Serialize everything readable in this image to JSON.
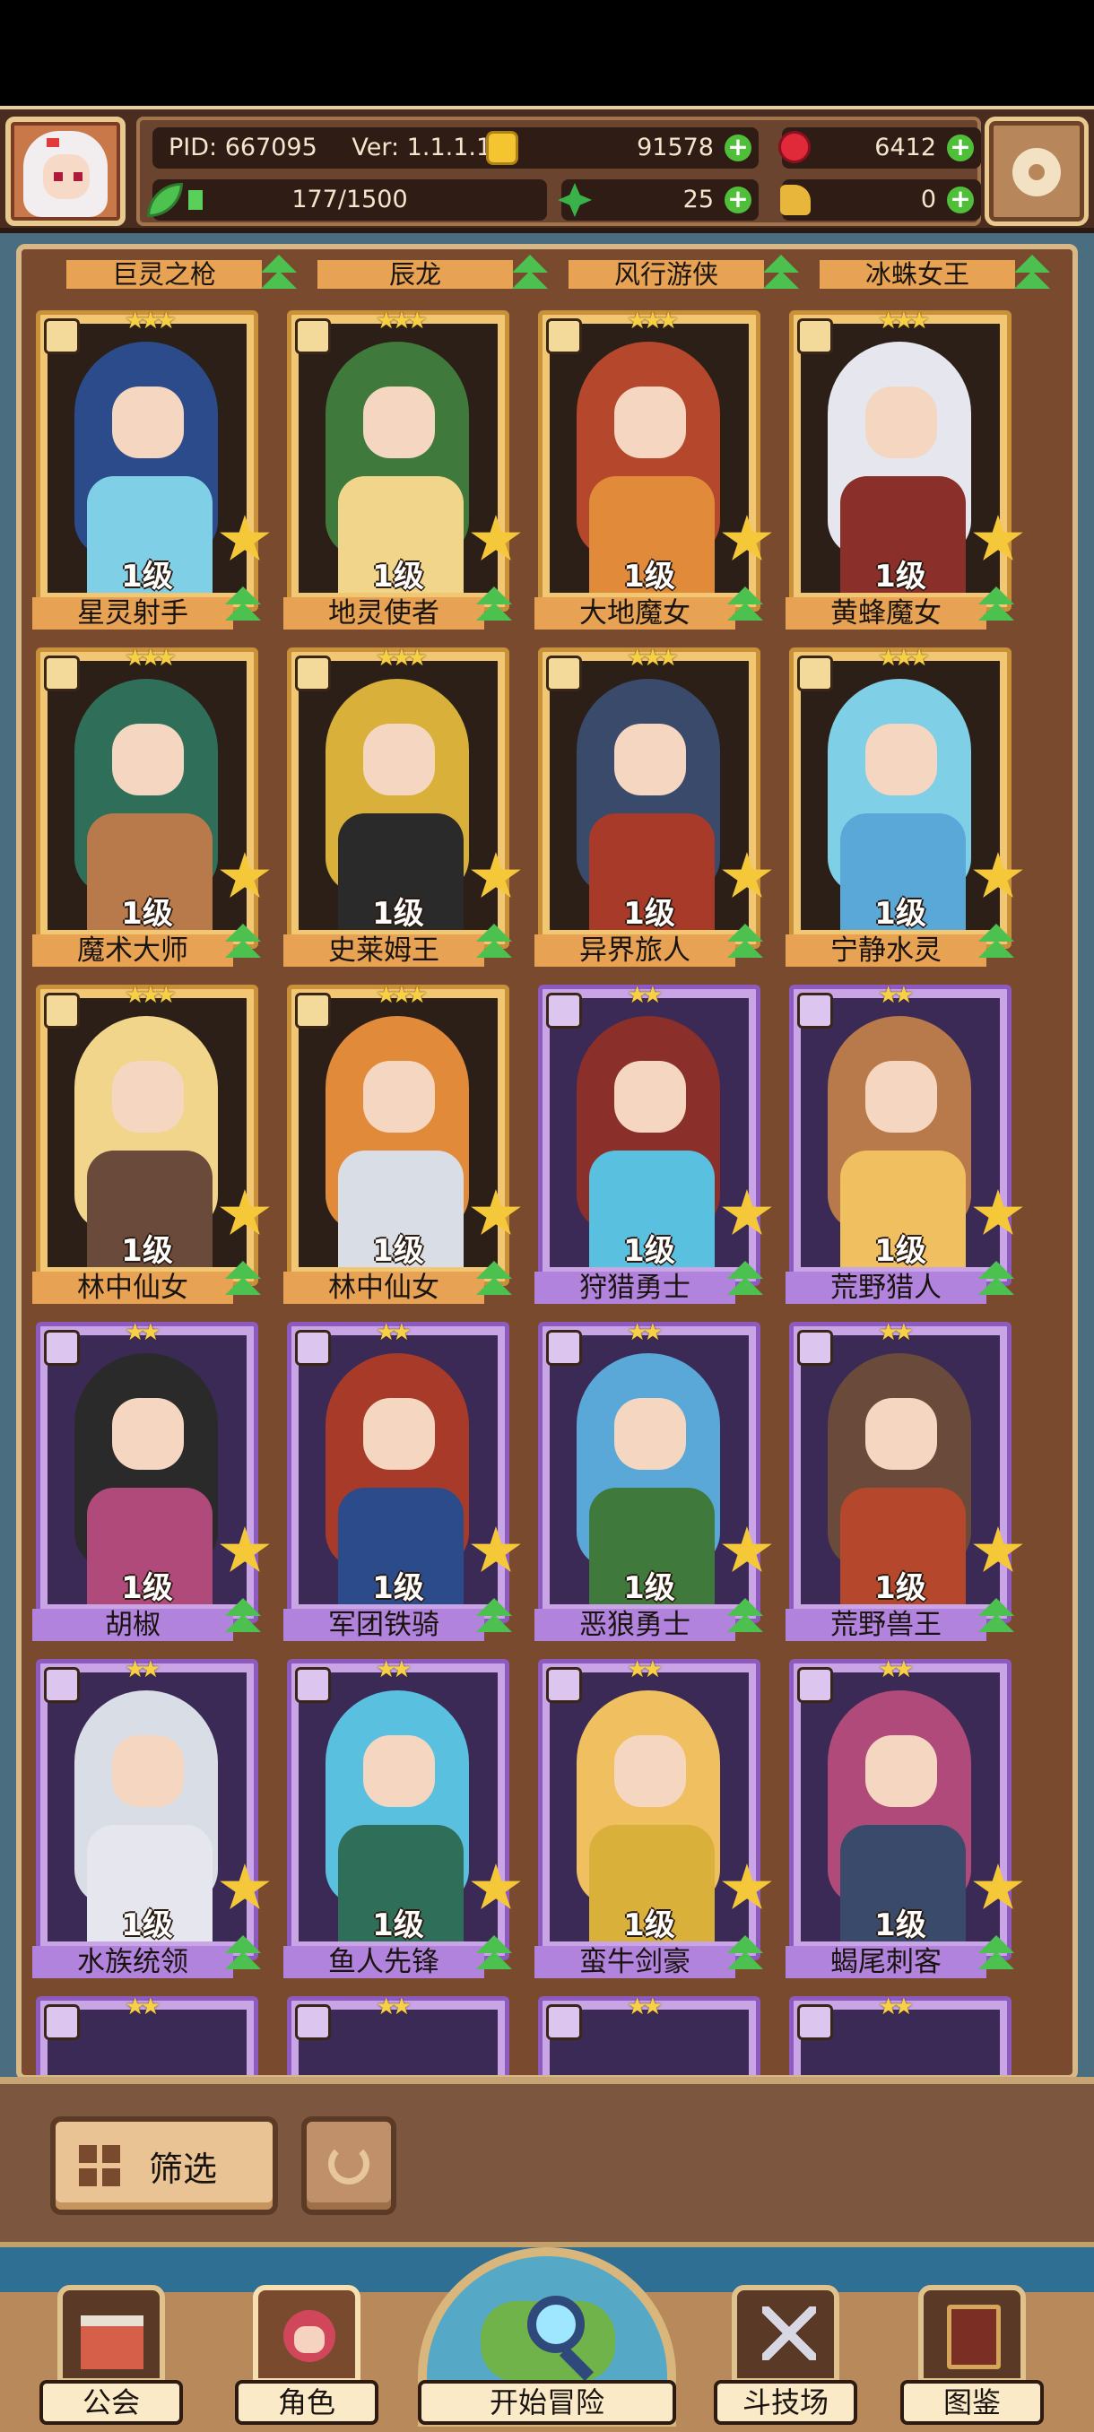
{
  "header": {
    "pid": "PID: 667095",
    "version": "Ver: 1.1.1.10",
    "energy": "177/1500",
    "gold": "91578",
    "gems": "6412",
    "clover": "25",
    "tokens": "0"
  },
  "top_strip": [
    "巨灵之枪",
    "辰龙",
    "风行游侠",
    "冰蛛女王"
  ],
  "heroes": [
    {
      "name": "星灵射手",
      "level": "1级",
      "rarity": "gold"
    },
    {
      "name": "地灵使者",
      "level": "1级",
      "rarity": "gold"
    },
    {
      "name": "大地魔女",
      "level": "1级",
      "rarity": "gold"
    },
    {
      "name": "黄蜂魔女",
      "level": "1级",
      "rarity": "gold"
    },
    {
      "name": "魔术大师",
      "level": "1级",
      "rarity": "gold"
    },
    {
      "name": "史莱姆王",
      "level": "1级",
      "rarity": "gold"
    },
    {
      "name": "异界旅人",
      "level": "1级",
      "rarity": "gold"
    },
    {
      "name": "宁静水灵",
      "level": "1级",
      "rarity": "gold"
    },
    {
      "name": "林中仙女",
      "level": "1级",
      "rarity": "gold"
    },
    {
      "name": "林中仙女",
      "level": "1级",
      "rarity": "gold"
    },
    {
      "name": "狩猎勇士",
      "level": "1级",
      "rarity": "purple"
    },
    {
      "name": "荒野猎人",
      "level": "1级",
      "rarity": "purple"
    },
    {
      "name": "胡椒",
      "level": "1级",
      "rarity": "purple"
    },
    {
      "name": "军团铁骑",
      "level": "1级",
      "rarity": "purple"
    },
    {
      "name": "恶狼勇士",
      "level": "1级",
      "rarity": "purple"
    },
    {
      "name": "荒野兽王",
      "level": "1级",
      "rarity": "purple"
    },
    {
      "name": "水族统领",
      "level": "1级",
      "rarity": "purple"
    },
    {
      "name": "鱼人先锋",
      "level": "1级",
      "rarity": "purple"
    },
    {
      "name": "蛮牛剑豪",
      "level": "1级",
      "rarity": "purple"
    },
    {
      "name": "蝎尾刺客",
      "level": "1级",
      "rarity": "purple"
    }
  ],
  "filter": {
    "label": "筛选"
  },
  "nav": {
    "guild": "公会",
    "role": "角色",
    "adventure": "开始冒险",
    "arena": "斗技场",
    "codex": "图鉴"
  },
  "colors": {
    "gold_frame": "#c9913a",
    "purple_frame": "#8d5ac0",
    "upgrade_green": "#4cc150"
  }
}
